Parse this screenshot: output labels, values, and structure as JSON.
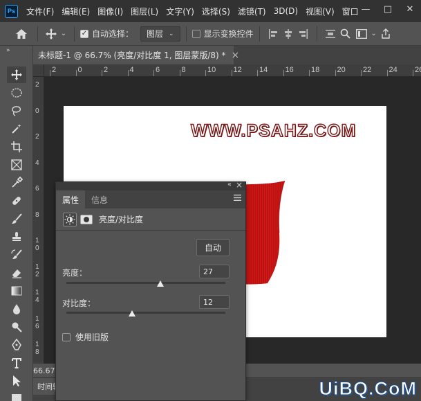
{
  "app": {
    "logo_text": "Ps",
    "menu": [
      "文件(F)",
      "编辑(E)",
      "图像(I)",
      "图层(L)",
      "文字(Y)",
      "选择(S)",
      "滤镜(T)",
      "3D(D)",
      "视图(V)",
      "窗口"
    ]
  },
  "window_controls": {
    "minimize": "—",
    "restore": "□",
    "close": "✕"
  },
  "options_bar": {
    "auto_select_checked": true,
    "auto_select_label": "自动选择：",
    "auto_select_target": "图层",
    "show_transform_checked": false,
    "show_transform_label": "显示变换控件"
  },
  "document": {
    "tab_title": "未标题-1 @ 66.7% (亮度/对比度 1, 图层蒙版/8) *",
    "close_glyph": "×"
  },
  "ruler": {
    "h_labels": [
      "2",
      "0",
      "2",
      "4",
      "6",
      "8",
      "10",
      "12",
      "14",
      "16",
      "18",
      "20",
      "22",
      "24",
      "26"
    ],
    "v_labels": [
      "2",
      "0",
      "2",
      "4",
      "6",
      "8",
      "1\n0",
      "1\n2",
      "1\n4",
      "1\n6",
      "1\n8"
    ]
  },
  "canvas": {
    "watermark_text": "WWW.PSAHZ.COM",
    "shape_color": "#d01818"
  },
  "status": {
    "zoom": "66.67%"
  },
  "timeline": {
    "tab_label": "时间轴"
  },
  "brand": {
    "text": "UiBQ.CoM"
  },
  "properties": {
    "tabs": [
      {
        "label": "属性",
        "active": true
      },
      {
        "label": "信息",
        "active": false
      }
    ],
    "adjustment_title": "亮度/对比度",
    "auto_label": "自动",
    "brightness": {
      "label": "亮度：",
      "value": "27",
      "min": -150,
      "max": 150
    },
    "contrast": {
      "label": "对比度：",
      "value": "12",
      "min": -50,
      "max": 100
    },
    "legacy": {
      "label": "使用旧版",
      "checked": false
    }
  }
}
